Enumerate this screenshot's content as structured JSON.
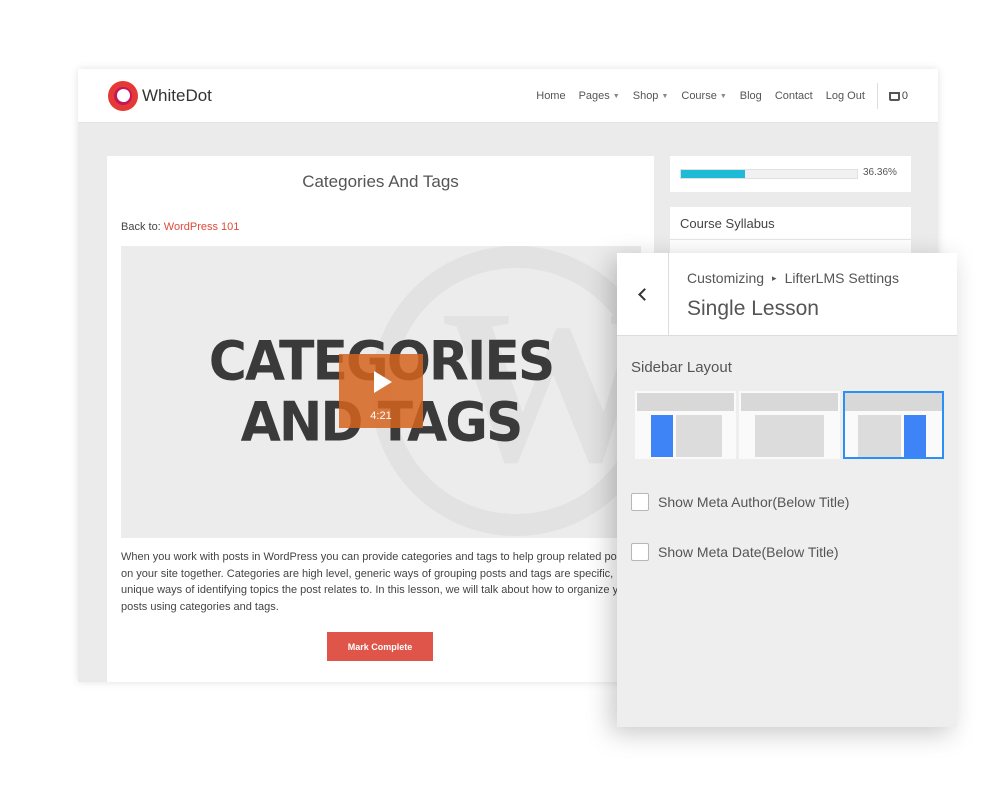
{
  "site": {
    "logo_text": "WhiteDot",
    "nav": [
      {
        "label": "Home",
        "has_caret": false
      },
      {
        "label": "Pages",
        "has_caret": true
      },
      {
        "label": "Shop",
        "has_caret": true
      },
      {
        "label": "Course",
        "has_caret": true
      },
      {
        "label": "Blog",
        "has_caret": false
      },
      {
        "label": "Contact",
        "has_caret": false
      },
      {
        "label": "Log Out",
        "has_caret": false
      }
    ],
    "cart_count": "0",
    "caret_glyph": "▼"
  },
  "lesson": {
    "title": "Categories And Tags",
    "back_prefix": "Back to: ",
    "back_link": "WordPress 101",
    "video": {
      "line1": "CATEGORIES",
      "line2": "AND TAGS",
      "duration": "4:21"
    },
    "description": "When you work with posts in WordPress you can provide categories and tags to help group related posts on your site together. Categories are high level, generic ways of grouping posts and tags are specific, more unique ways of identifying topics the post relates to. In this lesson, we will talk about how to organize your posts using categories and tags.",
    "mark_complete_label": "Mark Complete"
  },
  "sidebar": {
    "progress_text": "36.36%",
    "progress_fraction": 0.3636,
    "syllabus_title": "Course Syllabus"
  },
  "customizer": {
    "crumb_root": "Customizing",
    "crumb_child": "LifterLMS Settings",
    "crumb_arrow": "▸",
    "title": "Single Lesson",
    "section_label": "Sidebar Layout",
    "layouts": [
      {
        "name": "left-sidebar",
        "selected": false
      },
      {
        "name": "no-sidebar",
        "selected": false
      },
      {
        "name": "right-sidebar",
        "selected": true
      }
    ],
    "options": [
      {
        "label": "Show Meta Author(Below Title)",
        "checked": false
      },
      {
        "label": "Show Meta Date(Below Title)",
        "checked": false
      }
    ]
  },
  "colors": {
    "accent": "#e04b3a",
    "progress": "#1fbad6",
    "selected_border": "#2a8ff7",
    "sidebar_block": "#3f84f7"
  }
}
